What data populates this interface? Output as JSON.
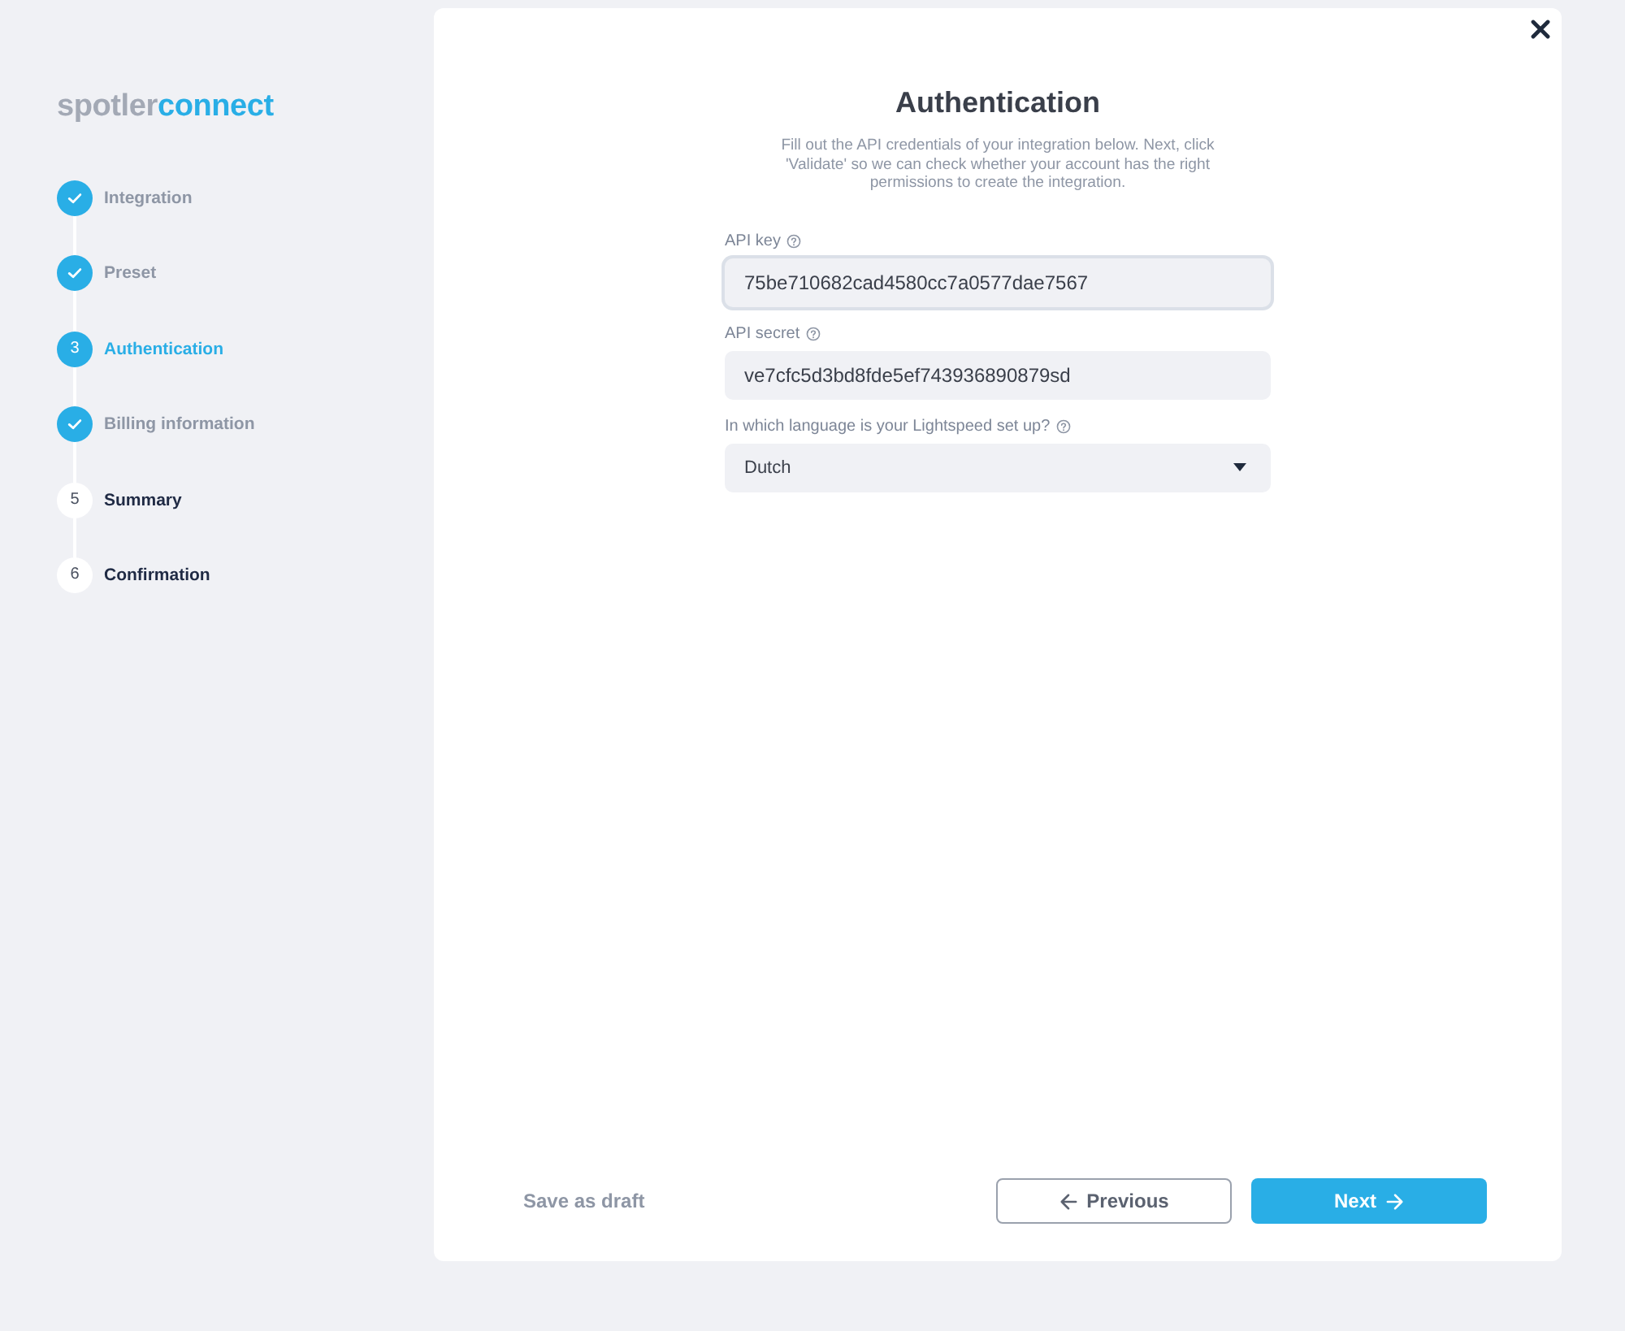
{
  "logo": {
    "light": "spotler",
    "accent": "connect"
  },
  "steps": [
    {
      "label": "Integration",
      "completed": true,
      "active": false
    },
    {
      "label": "Preset",
      "completed": true,
      "active": false
    },
    {
      "label": "Authentication",
      "completed": false,
      "active": true,
      "number": "3"
    },
    {
      "label": "Billing information",
      "completed": true,
      "active": false
    },
    {
      "label": "Summary",
      "completed": false,
      "active": false,
      "number": "5"
    },
    {
      "label": "Confirmation",
      "completed": false,
      "active": false,
      "number": "6"
    }
  ],
  "dialog": {
    "title": "Authentication",
    "description": "Fill out the API credentials of your integration below. Next, click 'Validate' so we can check whether your account has the right permissions to create the integration.",
    "fields": [
      {
        "kind": "text",
        "label": "API key",
        "value": "75be710682cad4580cc7a0577dae7567",
        "focused": true
      },
      {
        "kind": "text",
        "label": "API secret",
        "value": "ve7cfc5d3bd8fde5ef743936890879sd",
        "focused": false
      },
      {
        "kind": "select",
        "label": "In which language is your Lightspeed set up?",
        "value": "Dutch",
        "focused": false
      }
    ],
    "footer": {
      "draft_link": "Save as draft",
      "previous_button": "Previous",
      "next_button": "Next"
    }
  }
}
